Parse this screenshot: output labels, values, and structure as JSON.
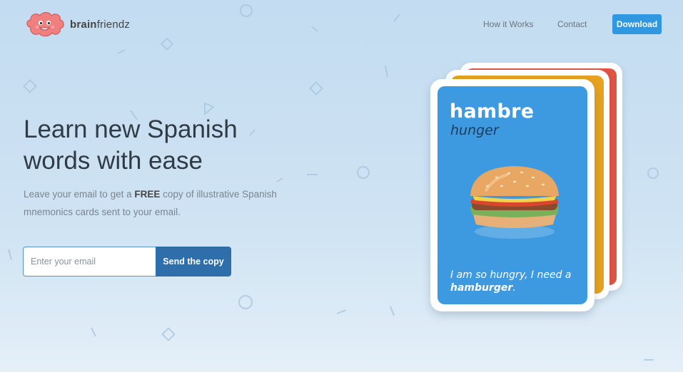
{
  "brand": {
    "name_bold": "brain",
    "name_rest": "friendz",
    "logo_icon": "brain-mascot-icon",
    "logo_color": "#f07f7f"
  },
  "nav": {
    "how_it_works": "How it Works",
    "contact": "Contact",
    "download": "Download",
    "download_color": "#2f98e0"
  },
  "hero": {
    "title": "Learn new Spanish words with ease",
    "subtitle_before": "Leave your email to get a ",
    "subtitle_bold": "FREE",
    "subtitle_after": " copy of illustrative Spanish mnemonics cards sent to your email."
  },
  "form": {
    "email_placeholder": "Enter your email",
    "email_value": "",
    "submit_label": "Send the copy",
    "submit_color": "#2e6fab"
  },
  "card": {
    "word": "hambre",
    "translation": "hunger",
    "sentence_before": "I am so hungry, I need a ",
    "sentence_bold": "hamburger",
    "sentence_after": ".",
    "illustration": "hamburger-icon",
    "front_color": "#3d9ae0",
    "stack_colors": [
      "#e8a21e",
      "#e05443"
    ]
  }
}
